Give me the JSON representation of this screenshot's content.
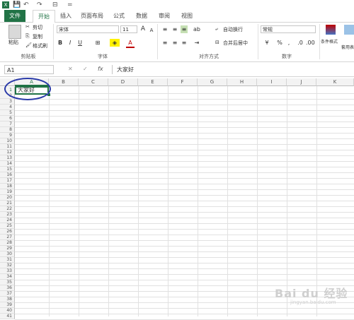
{
  "qat": {
    "save": "💾",
    "undo": "↶",
    "redo": "↷",
    "more": "⊟",
    "customize": "="
  },
  "tabs": [
    {
      "label": "文件"
    },
    {
      "label": "开始"
    },
    {
      "label": "插入"
    },
    {
      "label": "页面布局"
    },
    {
      "label": "公式"
    },
    {
      "label": "数据"
    },
    {
      "label": "审阅"
    },
    {
      "label": "视图"
    }
  ],
  "ribbon": {
    "clipboard": {
      "paste": "粘贴",
      "cut": "剪切",
      "copy": "复制",
      "format_painter": "格式刷",
      "label": "剪贴板"
    },
    "font": {
      "name": "宋体",
      "size": "11",
      "grow": "A",
      "shrink": "A",
      "bold": "B",
      "italic": "I",
      "underline": "U",
      "label": "字体",
      "font_color": "A"
    },
    "alignment": {
      "wrap": "自动换行",
      "merge": "合并后居中",
      "label": "对齐方式"
    },
    "number": {
      "format": "常规",
      "percent": "%",
      "comma": ",",
      "label": "数字"
    },
    "styles": {
      "cond": "条件格式",
      "table": "套用表格格式"
    }
  },
  "formula_bar": {
    "name_box": "A1",
    "cancel": "✕",
    "enter": "✓",
    "fx": "fx",
    "content": "大家好"
  },
  "columns": [
    "A",
    "B",
    "C",
    "D",
    "E",
    "F",
    "G",
    "H",
    "I",
    "J",
    "K"
  ],
  "rows": [
    "1",
    "2",
    "3",
    "4",
    "5",
    "6",
    "7",
    "8",
    "9",
    "10",
    "11",
    "12",
    "13",
    "14",
    "15",
    "16",
    "17",
    "18",
    "19",
    "20",
    "21",
    "22",
    "23",
    "24",
    "25",
    "26",
    "27",
    "28",
    "29",
    "30",
    "31",
    "32",
    "33",
    "34",
    "35",
    "36",
    "37",
    "38",
    "39",
    "40",
    "41"
  ],
  "cells": {
    "a1": "大家好"
  },
  "watermark": {
    "text": "Bai du 经验",
    "sub": "jingyan.baidu.com"
  },
  "colors": {
    "accent": "#217346",
    "annotation": "#2a3aa8"
  }
}
